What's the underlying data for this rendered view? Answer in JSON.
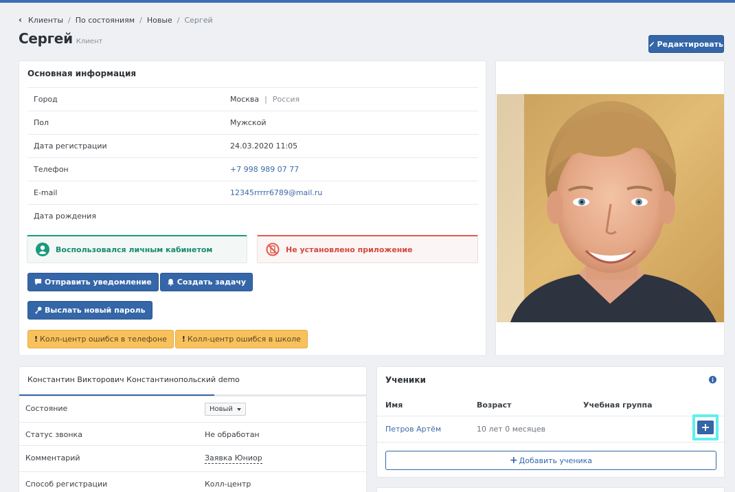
{
  "breadcrumb": {
    "items": [
      "Клиенты",
      "По состояниям",
      "Новые"
    ],
    "current": "Сергей",
    "separator": "/"
  },
  "header": {
    "name": "Сергей",
    "role": "Клиент",
    "edit_label": "Редактировать"
  },
  "info": {
    "title": "Основная информация",
    "rows": [
      {
        "label": "Город",
        "value": "Москва",
        "value2": "Россия"
      },
      {
        "label": "Пол",
        "value": "Мужской"
      },
      {
        "label": "Дата регистрации",
        "value": "24.03.2020 11:05"
      },
      {
        "label": "Телефон",
        "value": "+7 998 989 07 77"
      },
      {
        "label": "E-mail",
        "value": "12345rrrrr6789@mail.ru"
      },
      {
        "label": "Дата рождения",
        "value": ""
      }
    ],
    "status_ok": "Воспользовался личным кабинетом",
    "status_bad": "Не установлено приложение",
    "buttons": {
      "notify": "Отправить уведомление",
      "task": "Создать задачу",
      "password": "Выслать новый пароль",
      "err_phone": "Колл-центр ошибся в телефоне",
      "err_school": "Колл-центр ошибся в школе"
    }
  },
  "contact": {
    "tab": "Константин Викторович Константинопольский demo",
    "rows": [
      {
        "label": "Состояние",
        "value": "Новый"
      },
      {
        "label": "Статус звонка",
        "value": "Не обработан"
      },
      {
        "label": "Комментарий",
        "value": "Заявка Юниор"
      },
      {
        "label": "Способ регистрации",
        "value": "Колл-центр"
      }
    ]
  },
  "students": {
    "title": "Ученики",
    "columns": [
      "Имя",
      "Возраст",
      "Учебная группа"
    ],
    "rows": [
      {
        "name": "Петров Артём",
        "age": "10 лет 0 месяцев",
        "group": ""
      }
    ],
    "add_label": "Добавить ученика"
  },
  "colors": {
    "primary": "#3466a8",
    "success": "#1b9a7c",
    "danger": "#e35a4b",
    "warning": "#f8c15c",
    "highlight": "#5ff0ee"
  },
  "icons": [
    "chevron-left-icon",
    "pencil-icon",
    "user-circle-icon",
    "no-phone-icon",
    "comment-icon",
    "bell-icon",
    "key-icon",
    "exclamation-icon",
    "info-icon",
    "plus-icon"
  ]
}
